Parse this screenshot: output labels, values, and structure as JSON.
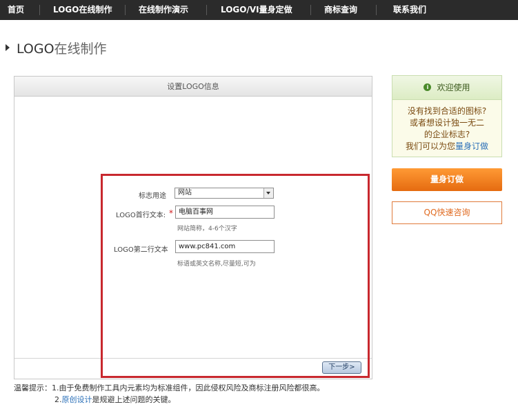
{
  "nav": {
    "items": [
      "首页",
      "LOGO在线制作",
      "在线制作演示",
      "LOGO/VI量身定做",
      "商标查询",
      "联系我们"
    ]
  },
  "page": {
    "title_part1": "LOGO",
    "title_part2": "在线制作"
  },
  "panel": {
    "header": "设置LOGO信息",
    "form": {
      "usage_label": "标志用途",
      "usage_value": "网站",
      "line1_label": "LOGO首行文本:",
      "line1_required_mark": "*",
      "line1_value": "电脑百事网",
      "line1_hint": "网站简称，4-6个汉字",
      "line2_label": "LOGO第二行文本",
      "line2_value": "www.pc841.com",
      "line2_hint": "标语或英文名称,尽量短,可为"
    },
    "next_button": "下一步>"
  },
  "tips": {
    "prefix": "温馨提示：",
    "line1": "1.由于免费制作工具内元素均为标准组件，因此侵权风险及商标注册风险都很高。",
    "line2_num": "2.",
    "line2_link": "原创设计",
    "line2_rest": "是规避上述问题的关键。"
  },
  "sidebar": {
    "welcome_title": "欢迎使用",
    "welcome_line1": "没有找到合适的图标?",
    "welcome_line2": "或者想设计独一无二",
    "welcome_line3": "的企业标志?",
    "welcome_line4_text": "我们可以为您",
    "welcome_line4_link": "量身订做",
    "custom_button": "量身订做",
    "qq_button": "QQ快速咨询"
  },
  "colors": {
    "nav_bg": "#2b2b2b",
    "highlight_border": "#c8282e",
    "orange": "#f08020",
    "link": "#2a6fb8"
  }
}
